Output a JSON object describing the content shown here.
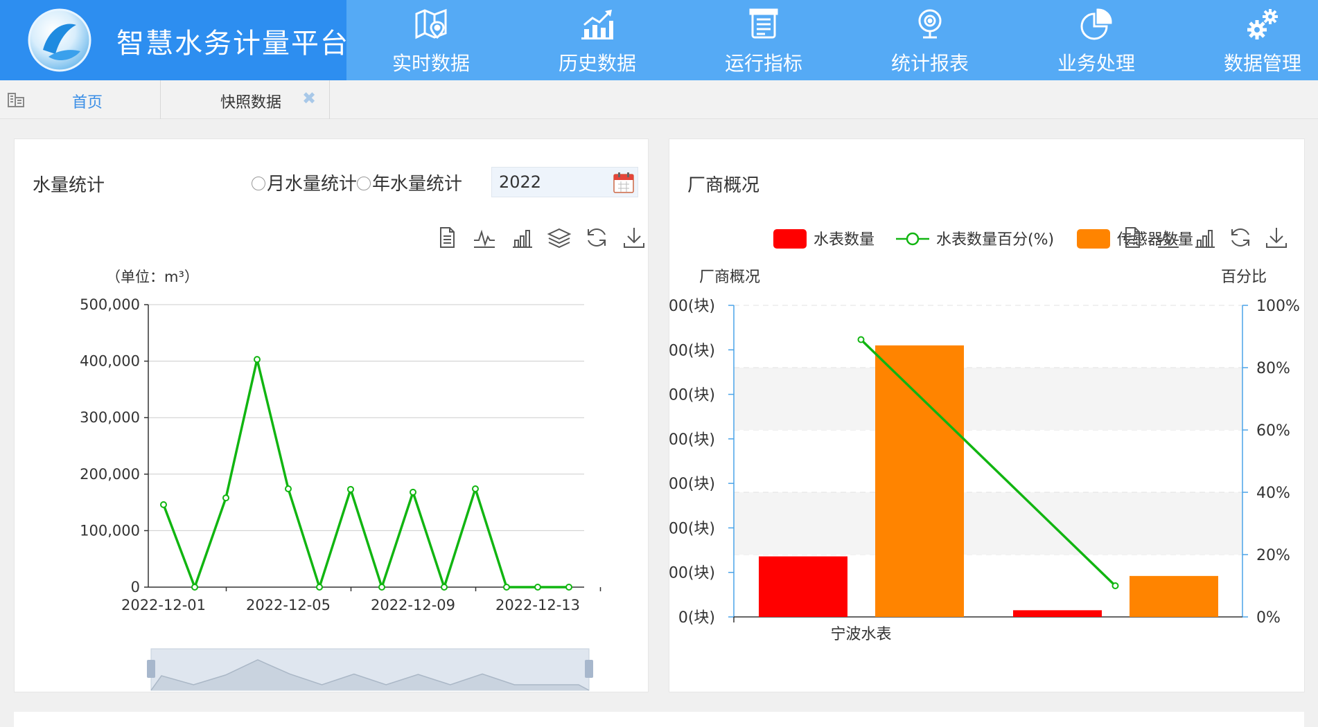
{
  "app": {
    "title": "智慧水务计量平台",
    "nav": [
      {
        "label": "实时数据",
        "icon": "map-pin-icon"
      },
      {
        "label": "历史数据",
        "icon": "bar-chart-trend-icon"
      },
      {
        "label": "运行指标",
        "icon": "clipboard-list-icon"
      },
      {
        "label": "统计报表",
        "icon": "webcam-icon"
      },
      {
        "label": "业务处理",
        "icon": "pie-chart-icon"
      },
      {
        "label": "数据管理",
        "icon": "gears-icon"
      }
    ]
  },
  "tabs": {
    "home_label": "首页",
    "snapshot_label": "快照数据",
    "close_glyph": "✖"
  },
  "water_panel": {
    "title": "水量统计",
    "radio_month": "月水量统计",
    "radio_year": "年水量统计",
    "year_value": "2022"
  },
  "vendor_panel": {
    "title": "厂商概况"
  },
  "colors": {
    "header_bg": "#55aaf5",
    "brand_bg": "#2d8ef0",
    "line_green": "#11b511",
    "bar_red": "#ff0000",
    "bar_orange": "#ff8400",
    "axis_blue": "#4aa3e8"
  },
  "chart_data": [
    {
      "type": "line",
      "ylabel": "（单位：m³）",
      "x": [
        "2022-12-01",
        "2022-12-02",
        "2022-12-03",
        "2022-12-04",
        "2022-12-05",
        "2022-12-06",
        "2022-12-07",
        "2022-12-08",
        "2022-12-09",
        "2022-12-10",
        "2022-12-11",
        "2022-12-12",
        "2022-12-13",
        "2022-12-14"
      ],
      "x_tick_labels": [
        "2022-12-01",
        "2022-12-05",
        "2022-12-09",
        "2022-12-13"
      ],
      "values": [
        146000,
        0,
        158000,
        403000,
        174000,
        0,
        173000,
        0,
        168000,
        0,
        174000,
        0,
        0,
        0
      ],
      "ylim": [
        0,
        500000
      ],
      "y_tick_labels": [
        "0",
        "100,000",
        "200,000",
        "300,000",
        "400,000",
        "500,000"
      ],
      "grid": true,
      "data_zoom": true
    },
    {
      "type": "bar",
      "title": "厂商概况",
      "ylabel": "厂商概况",
      "y2label": "百分比",
      "categories": [
        "宁波水表",
        ""
      ],
      "series": [
        {
          "name": "水表数量",
          "values": [
            1360,
            150
          ]
        },
        {
          "name": "传感器数量",
          "values": [
            6100,
            920
          ]
        },
        {
          "name": "水表数量百分(%)",
          "type": "line",
          "values": [
            89,
            10
          ]
        }
      ],
      "y_tick_labels": [
        "0(块)",
        "00(块)",
        "00(块)",
        "00(块)",
        "00(块)",
        "00(块)",
        "00(块)",
        "00(块)"
      ],
      "y2_tick_labels": [
        "0%",
        "20%",
        "40%",
        "60%",
        "80%",
        "100%"
      ],
      "ylim": [
        0,
        7000
      ],
      "y2lim": [
        0,
        100
      ],
      "legend": "top"
    }
  ]
}
